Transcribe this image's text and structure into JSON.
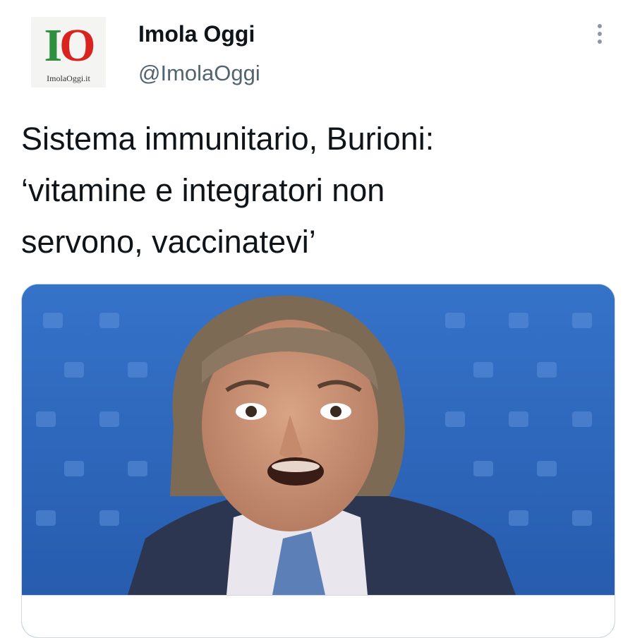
{
  "tweet": {
    "author": {
      "display_name": "Imola Oggi",
      "handle": "@ImolaOggi",
      "avatar": {
        "mark_letter_1": "I",
        "mark_letter_2": "O",
        "caption": "ImolaOggi.it"
      }
    },
    "text_lines": [
      "Sistema immunitario, Burioni:",
      "‘vitamine e integratori non",
      "servono, vaccinatevi’"
    ],
    "more_icon": "more-vertical-icon",
    "media": {
      "description_icon": "photo",
      "background_color": "#2f6fc4"
    }
  },
  "colors": {
    "text_primary": "#0f1419",
    "text_secondary": "#536471",
    "logo_green": "#2e8f3e",
    "logo_red": "#d8231f",
    "card_border": "#cfd9de"
  }
}
